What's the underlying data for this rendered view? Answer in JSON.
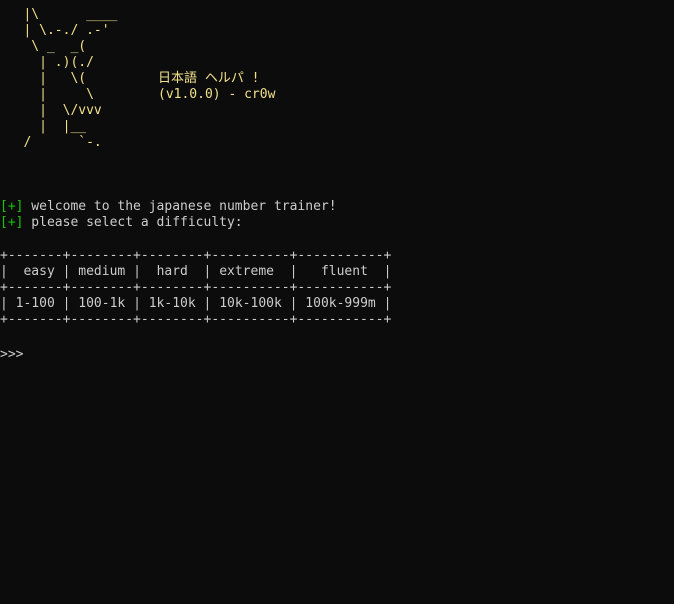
{
  "ascii_art": "   |\\      ____\n   | \\.-./ .-'\n    \\ _  _(\n     | .)(./\n     |   \\(\n     |     \\\n     |  \\/vvv\n     |  |__\n   /      `-.",
  "banner": {
    "title": "日本語 ヘルパ !",
    "version": "(v1.0.0) - cr0w"
  },
  "messages": [
    {
      "tag": "[+]",
      "text": " welcome to the japanese number trainer!"
    },
    {
      "tag": "[+]",
      "text": " please select a difficulty:"
    }
  ],
  "difficulty_table": {
    "border": "+-------+--------+--------+----------+-----------+",
    "columns": [
      "easy",
      "medium",
      "hard",
      "extreme",
      "fluent"
    ],
    "ranges": [
      "1-100",
      "100-1k",
      "1k-10k",
      "10k-100k",
      "100k-999m"
    ]
  },
  "prompt": ">>>",
  "colors": {
    "background": "#0c0c0c",
    "art": "#f0e08a",
    "tag_green": "#16c60c",
    "text": "#cccccc"
  }
}
